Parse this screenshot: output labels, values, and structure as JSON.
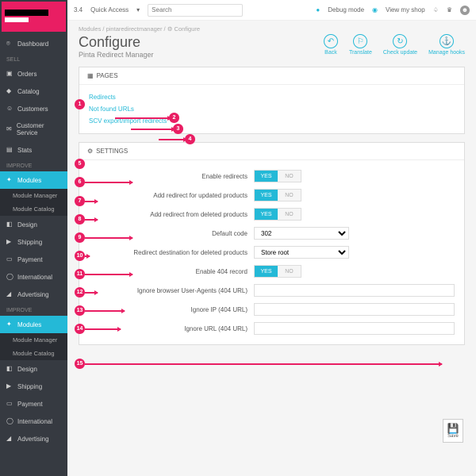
{
  "topbar": {
    "version": "3.4",
    "quick": "Quick Access",
    "search": "Search",
    "debug": "Debug mode",
    "shop": "View my shop"
  },
  "crumbs": "Modules  /  pintaredirectmanager  /  ⚙ Configure",
  "title": "Configure",
  "subtitle": "Pinta Redirect Manager",
  "actions": {
    "back": "Back",
    "translate": "Translate",
    "check": "Check update",
    "hooks": "Manage hooks"
  },
  "sidebar": {
    "dashboard": "Dashboard",
    "sell": "SELL",
    "orders": "Orders",
    "catalog": "Catalog",
    "customers": "Customers",
    "service": "Customer Service",
    "stats": "Stats",
    "improve": "IMPROVE",
    "modules": "Modules",
    "mm": "Module Manager",
    "mc": "Module Catalog",
    "design": "Design",
    "shipping": "Shipping",
    "payment": "Payment",
    "intl": "International",
    "adv": "Advertising",
    "improve2": "IMPROVE",
    "modules2": "Modules"
  },
  "pages": {
    "head": "PAGES",
    "redirects": "Redirects",
    "notfound": "Not found URLs",
    "csv": "SCV export/import redirects"
  },
  "settings": {
    "head": "SETTINGS",
    "enable": "Enable redirects",
    "updated": "Add redirect for updated products",
    "deleted": "Add redirect from deleted products",
    "code": "Default code",
    "codeval": "302",
    "dest": "Redirect destination for deleted products",
    "destval": "Store root",
    "rec": "Enable 404 record",
    "ua": "Ignore browser User-Agents (404 URL)",
    "ip": "Ignore IP (404 URL)",
    "url": "Ignore URL (404 URL)",
    "yes": "YES",
    "no": "NO"
  },
  "save": "Save"
}
